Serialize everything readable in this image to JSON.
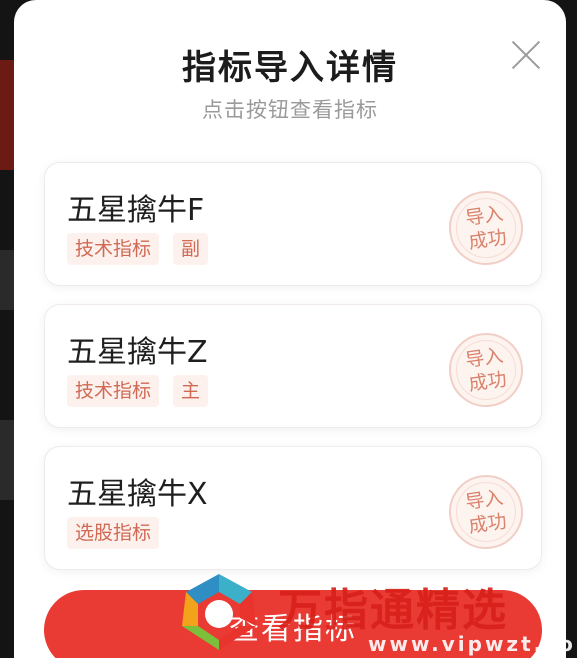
{
  "dialog": {
    "title": "指标导入详情",
    "subtitle": "点击按钮查看指标",
    "close_icon": "close-icon"
  },
  "indicators": [
    {
      "name": "五星擒牛F",
      "tags": [
        "技术指标",
        "副"
      ],
      "status": [
        "导入",
        "成功"
      ]
    },
    {
      "name": "五星擒牛Z",
      "tags": [
        "技术指标",
        "主"
      ],
      "status": [
        "导入",
        "成功"
      ]
    },
    {
      "name": "五星擒牛X",
      "tags": [
        "选股指标"
      ],
      "status": [
        "导入",
        "成功"
      ]
    }
  ],
  "primary_button": {
    "label": "查看指标"
  },
  "watermark": {
    "text": "万指通精选",
    "url": "www.vipwzt.com"
  },
  "colors": {
    "accent": "#e93a33",
    "tag_text": "#d06a55",
    "tag_bg": "#fdf1ed",
    "stamp": "#d9826c"
  }
}
